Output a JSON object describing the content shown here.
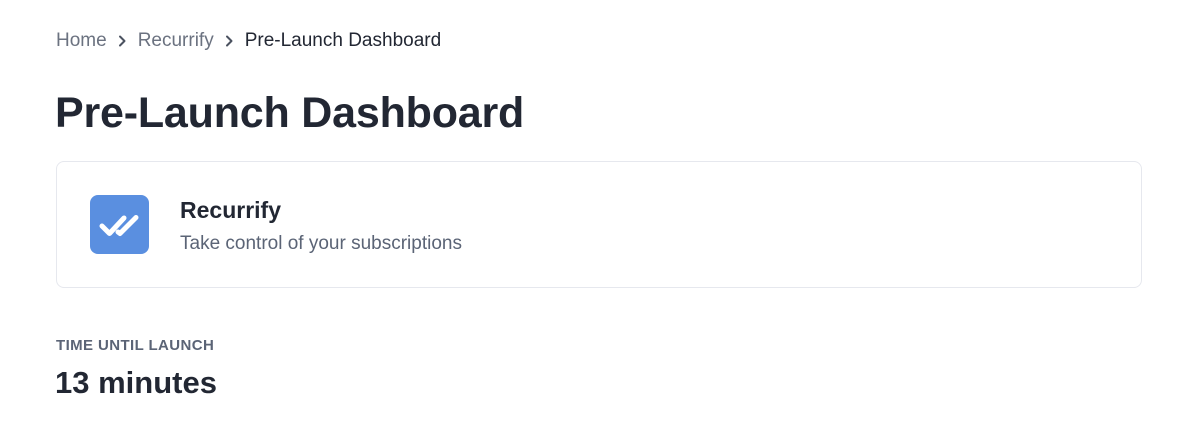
{
  "breadcrumb": {
    "items": [
      {
        "label": "Home"
      },
      {
        "label": "Recurrify"
      },
      {
        "label": "Pre-Launch Dashboard"
      }
    ],
    "separator_icon": "chevron-right-icon"
  },
  "page": {
    "title": "Pre-Launch Dashboard"
  },
  "product": {
    "name": "Recurrify",
    "tagline": "Take control of your subscriptions",
    "logo_icon": "double-check-icon",
    "logo_color": "#5a8fe0"
  },
  "launch": {
    "label": "TIME UNTIL LAUNCH",
    "value": "13 minutes"
  },
  "colors": {
    "text_primary": "#222733",
    "text_secondary": "#5b6476",
    "breadcrumb_muted": "#6b7280",
    "card_border": "#e6e8ee"
  }
}
